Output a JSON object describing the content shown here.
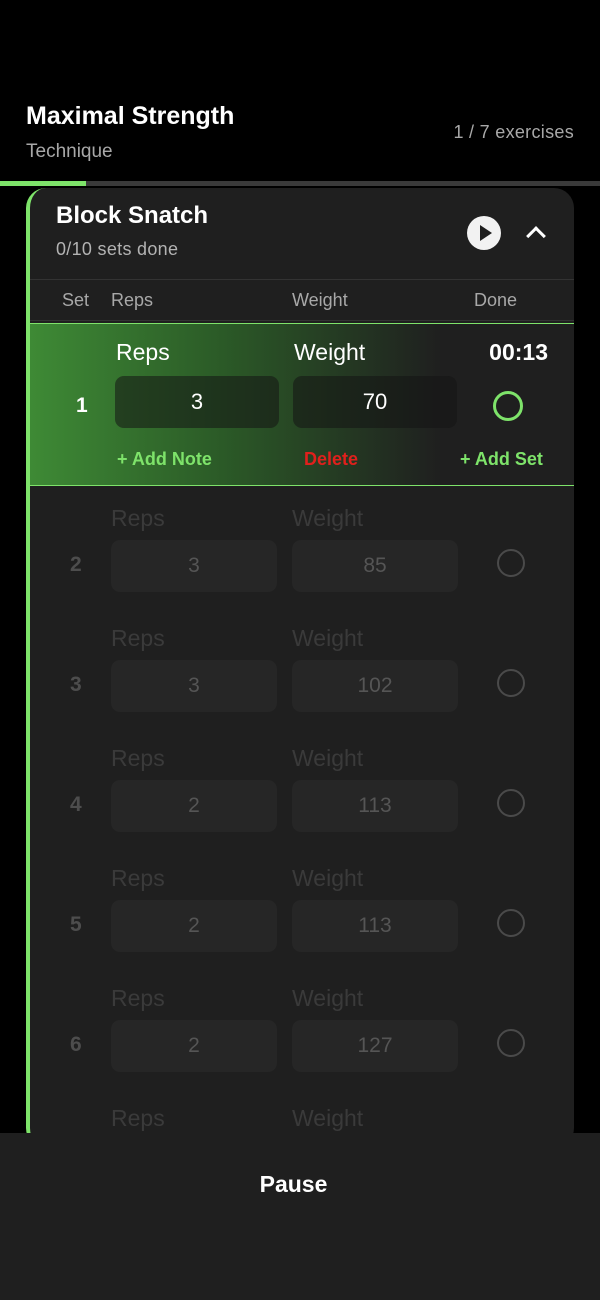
{
  "workout": {
    "title": "Maximal Strength",
    "subtitle": "Technique",
    "progress_text": "1 / 7 exercises",
    "progress_fraction": 0.143
  },
  "exercise": {
    "name": "Block Snatch",
    "sets_done": "0/10 sets done",
    "columns": {
      "set": "Set",
      "reps": "Reps",
      "weight": "Weight",
      "done": "Done"
    }
  },
  "active_set": {
    "number": "1",
    "reps_label": "Reps",
    "weight_label": "Weight",
    "timer": "00:13",
    "reps": "3",
    "weight": "70",
    "add_note": "+ Add Note",
    "delete": "Delete",
    "add_set": "+ Add Set"
  },
  "sets": [
    {
      "number": "2",
      "reps_label": "Reps",
      "weight_label": "Weight",
      "reps": "3",
      "weight": "85"
    },
    {
      "number": "3",
      "reps_label": "Reps",
      "weight_label": "Weight",
      "reps": "3",
      "weight": "102"
    },
    {
      "number": "4",
      "reps_label": "Reps",
      "weight_label": "Weight",
      "reps": "2",
      "weight": "113"
    },
    {
      "number": "5",
      "reps_label": "Reps",
      "weight_label": "Weight",
      "reps": "2",
      "weight": "113"
    },
    {
      "number": "6",
      "reps_label": "Reps",
      "weight_label": "Weight",
      "reps": "2",
      "weight": "127"
    },
    {
      "number": "",
      "reps_label": "Reps",
      "weight_label": "Weight",
      "reps": "",
      "weight": ""
    }
  ],
  "footer": {
    "pause_label": "Pause"
  },
  "colors": {
    "accent": "#7ee36a",
    "delete": "#e0201c",
    "card": "#1f1f1f",
    "background": "#000000"
  },
  "icons": {
    "play": "play-icon",
    "collapse": "chevron-up-icon"
  }
}
